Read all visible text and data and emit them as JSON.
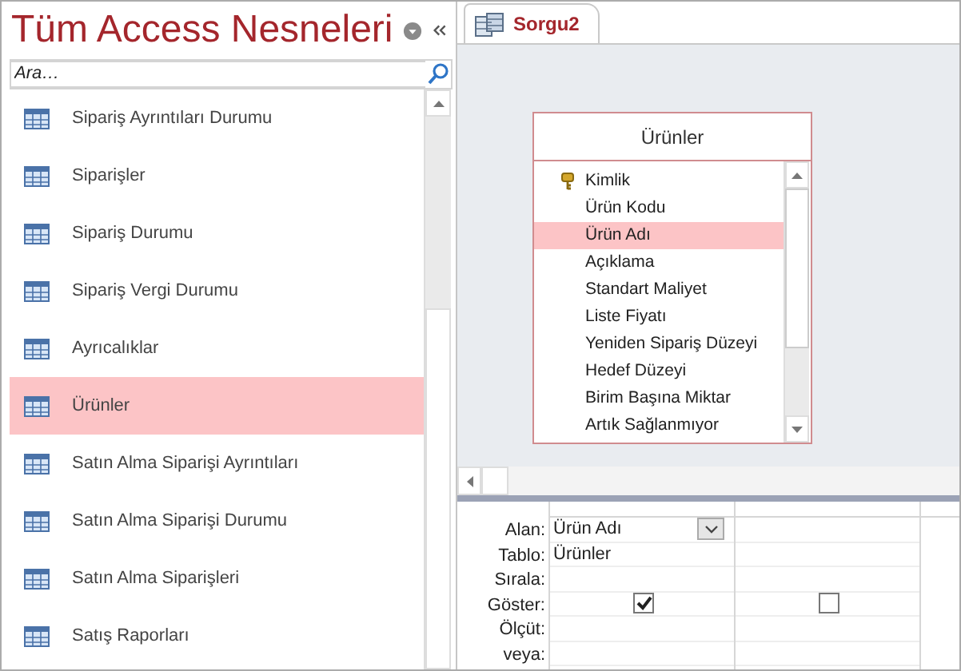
{
  "navigation_pane": {
    "title": "Tüm Access Nesneleri",
    "search": {
      "placeholder": "Ara…"
    },
    "items": [
      {
        "label": "Sipariş Ayrıntıları Durumu",
        "selected": false
      },
      {
        "label": "Siparişler",
        "selected": false
      },
      {
        "label": "Sipariş Durumu",
        "selected": false
      },
      {
        "label": "Sipariş Vergi Durumu",
        "selected": false
      },
      {
        "label": "Ayrıcalıklar",
        "selected": false
      },
      {
        "label": "Ürünler",
        "selected": true
      },
      {
        "label": "Satın Alma Siparişi Ayrıntıları",
        "selected": false
      },
      {
        "label": "Satın Alma Siparişi Durumu",
        "selected": false
      },
      {
        "label": "Satın Alma Siparişleri",
        "selected": false
      },
      {
        "label": "Satış Raporları",
        "selected": false
      }
    ]
  },
  "tabs": [
    {
      "label": "Sorgu2",
      "selected": true
    }
  ],
  "table_box": {
    "title": "Ürünler",
    "fields": [
      {
        "label": "Kimlik",
        "kind": "key",
        "selected": false
      },
      {
        "label": "Ürün Kodu",
        "kind": "field",
        "selected": false
      },
      {
        "label": "Ürün Adı",
        "kind": "field",
        "selected": true
      },
      {
        "label": "Açıklama",
        "kind": "field",
        "selected": false
      },
      {
        "label": "Standart Maliyet",
        "kind": "field",
        "selected": false
      },
      {
        "label": "Liste Fiyatı",
        "kind": "field",
        "selected": false
      },
      {
        "label": "Yeniden Sipariş Düzeyi",
        "kind": "field",
        "selected": false
      },
      {
        "label": "Hedef Düzeyi",
        "kind": "field",
        "selected": false
      },
      {
        "label": "Birim Başına Miktar",
        "kind": "field",
        "selected": false
      },
      {
        "label": "Artık Sağlanmıyor",
        "kind": "field",
        "selected": false
      }
    ]
  },
  "design_grid": {
    "row_labels": [
      "Alan:",
      "Tablo:",
      "Sırala:",
      "Göster:",
      "Ölçüt:",
      "veya:"
    ],
    "columns": [
      {
        "field": "Ürün Adı",
        "table": "Ürünler",
        "dropdown": true,
        "show": true
      },
      {
        "dropdown": false,
        "show": false
      }
    ]
  }
}
